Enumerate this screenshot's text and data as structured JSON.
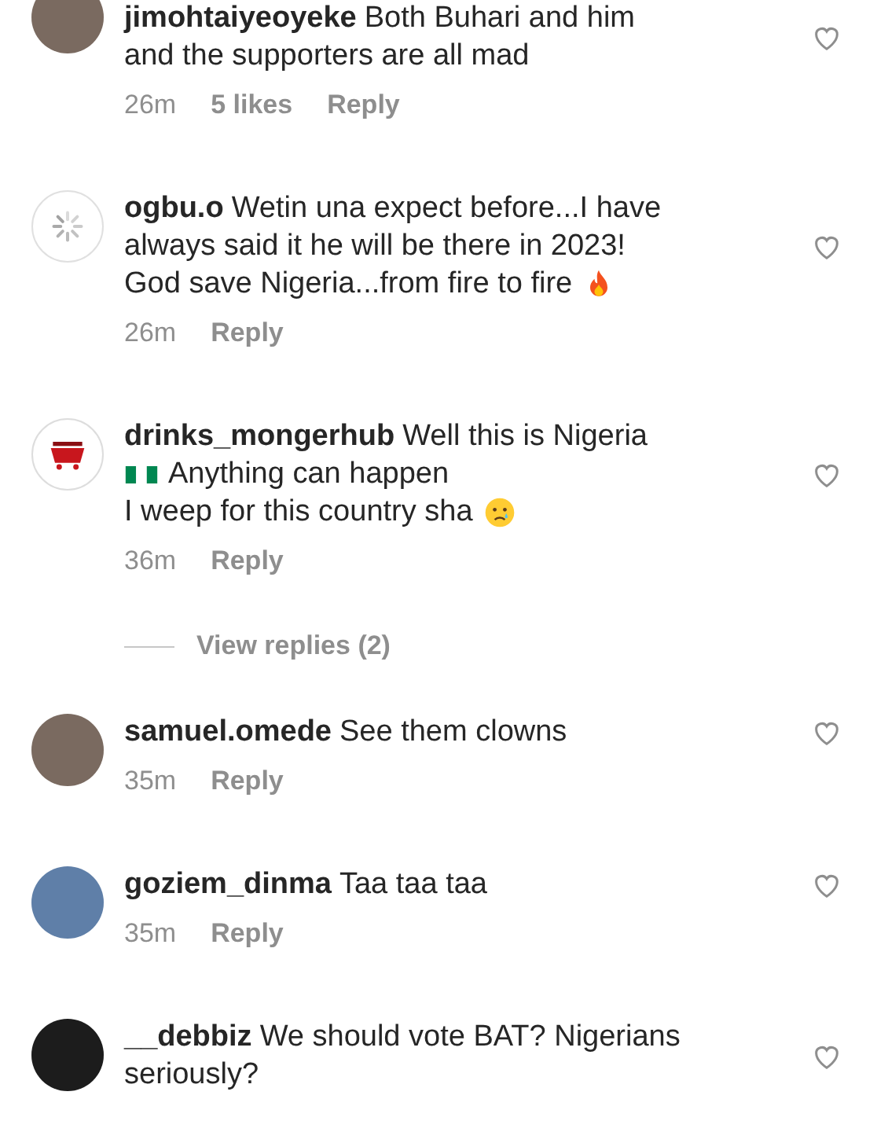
{
  "comments": [
    {
      "avatar": {
        "kind": "photo"
      },
      "username": "jimohtaiyeoyeke",
      "lines": [
        [
          {
            "kind": "text",
            "text": "Both Buhari and him"
          }
        ],
        [
          {
            "kind": "text",
            "text": "and the supporters are all mad"
          }
        ]
      ],
      "time": "26m",
      "likes": "5 likes",
      "reply": "Reply"
    },
    {
      "avatar": {
        "kind": "spinner"
      },
      "username": "ogbu.o",
      "lines": [
        [
          {
            "kind": "text",
            "text": "Wetin una expect before...I have"
          }
        ],
        [
          {
            "kind": "text",
            "text": "always said it he will be there in 2023!"
          }
        ],
        [
          {
            "kind": "text",
            "text": "God save Nigeria...from fire to fire"
          },
          {
            "kind": "fire"
          }
        ]
      ],
      "time": "26m",
      "reply": "Reply"
    },
    {
      "avatar": {
        "kind": "logo"
      },
      "username": "drinks_mongerhub",
      "lines": [
        [
          {
            "kind": "text",
            "text": "Well this is Nigeria"
          }
        ],
        [
          {
            "kind": "flag"
          },
          {
            "kind": "text",
            "text": "Anything can happen"
          }
        ],
        [
          {
            "kind": "text",
            "text": "I weep for this country sha"
          },
          {
            "kind": "crying"
          }
        ]
      ],
      "time": "36m",
      "reply": "Reply",
      "view_replies": "View replies (2)"
    },
    {
      "avatar": {
        "kind": "photo"
      },
      "username": "samuel.omede",
      "lines": [
        [
          {
            "kind": "text",
            "text": "See them clowns"
          }
        ]
      ],
      "time": "35m",
      "reply": "Reply"
    },
    {
      "avatar": {
        "kind": "photo"
      },
      "username": "goziem_dinma",
      "lines": [
        [
          {
            "kind": "text",
            "text": "Taa taa taa"
          }
        ]
      ],
      "time": "35m",
      "reply": "Reply"
    },
    {
      "avatar": {
        "kind": "dark"
      },
      "username": "__debbiz",
      "lines": [
        [
          {
            "kind": "text",
            "text": "We should vote BAT? Nigerians"
          }
        ],
        [
          {
            "kind": "text",
            "text": "seriously?"
          }
        ]
      ]
    }
  ]
}
